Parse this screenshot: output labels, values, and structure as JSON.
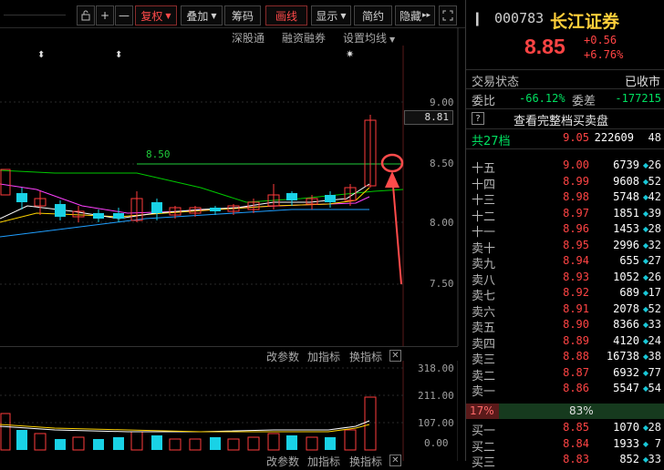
{
  "toolbar": {
    "icons": [
      "lock-icon",
      "crosshair-plus-icon",
      "minus-icon"
    ],
    "fuquan": "复权",
    "diejia": "叠加",
    "chouma": "筹码",
    "huaxian": "画线",
    "xianshi": "显示",
    "jianyue": "简约",
    "yincang": "隐藏",
    "fullscreen_icon": "expand-icon"
  },
  "subnav": {
    "shengutong": "深股通",
    "rongzi": "融资融券",
    "junxian": "设置均线"
  },
  "main_chart": {
    "y_ticks": [
      "9.00",
      "8.50",
      "8.00",
      "7.50"
    ],
    "current_price_tag": "8.81",
    "hline_label": "8.50",
    "colors": {
      "up": "#ff3b3b",
      "down": "#19d2e6",
      "ma5": "#ffffff",
      "ma10": "#ffd400",
      "ma20": "#ff40ff",
      "ma60": "#00c800",
      "ma120": "#1f9fff"
    }
  },
  "sub_chart": {
    "toolbar": {
      "params": "改参数",
      "add": "加指标",
      "swap": "换指标"
    },
    "y_ticks": [
      "318.00",
      "211.00",
      "107.00",
      "0.00"
    ],
    "bottom_toolbar": {
      "params": "改参数",
      "add": "加指标",
      "swap": "换指标"
    }
  },
  "quote": {
    "code": "000783",
    "name": "长江证券",
    "price": "8.85",
    "change": "+0.56",
    "change_pct": "+6.76%",
    "status_label": "交易状态",
    "status_value": "已收市",
    "weibi_label": "委比",
    "weibi_value": "-66.12%",
    "weicha_label": "委差",
    "weicha_value": "-177215",
    "help_icon": "?",
    "full_book_label": "查看完整档买卖盘",
    "total_label": "共27档",
    "total_price": "9.05",
    "total_vol": "222609",
    "total_cnt": "48",
    "ratio_left": "17%",
    "ratio_mid": "83%"
  },
  "asks": [
    {
      "label": "十五",
      "price": "9.00",
      "vol": "6739",
      "cnt": "26"
    },
    {
      "label": "十四",
      "price": "8.99",
      "vol": "9608",
      "cnt": "52"
    },
    {
      "label": "十三",
      "price": "8.98",
      "vol": "5748",
      "cnt": "42"
    },
    {
      "label": "十二",
      "price": "8.97",
      "vol": "1851",
      "cnt": "39"
    },
    {
      "label": "十一",
      "price": "8.96",
      "vol": "1453",
      "cnt": "28"
    },
    {
      "label": "卖十",
      "price": "8.95",
      "vol": "2996",
      "cnt": "32"
    },
    {
      "label": "卖九",
      "price": "8.94",
      "vol": "655",
      "cnt": "27"
    },
    {
      "label": "卖八",
      "price": "8.93",
      "vol": "1052",
      "cnt": "26"
    },
    {
      "label": "卖七",
      "price": "8.92",
      "vol": "689",
      "cnt": "17"
    },
    {
      "label": "卖六",
      "price": "8.91",
      "vol": "2078",
      "cnt": "52"
    },
    {
      "label": "卖五",
      "price": "8.90",
      "vol": "8366",
      "cnt": "33"
    },
    {
      "label": "卖四",
      "price": "8.89",
      "vol": "4120",
      "cnt": "24"
    },
    {
      "label": "卖三",
      "price": "8.88",
      "vol": "16738",
      "cnt": "38"
    },
    {
      "label": "卖二",
      "price": "8.87",
      "vol": "6932",
      "cnt": "77"
    },
    {
      "label": "卖一",
      "price": "8.86",
      "vol": "5547",
      "cnt": "54"
    }
  ],
  "bids": [
    {
      "label": "买一",
      "price": "8.85",
      "vol": "1070",
      "cnt": "28"
    },
    {
      "label": "买二",
      "price": "8.84",
      "vol": "1933",
      "cnt": "7"
    },
    {
      "label": "买三",
      "price": "8.83",
      "vol": "852",
      "cnt": "33"
    }
  ]
}
